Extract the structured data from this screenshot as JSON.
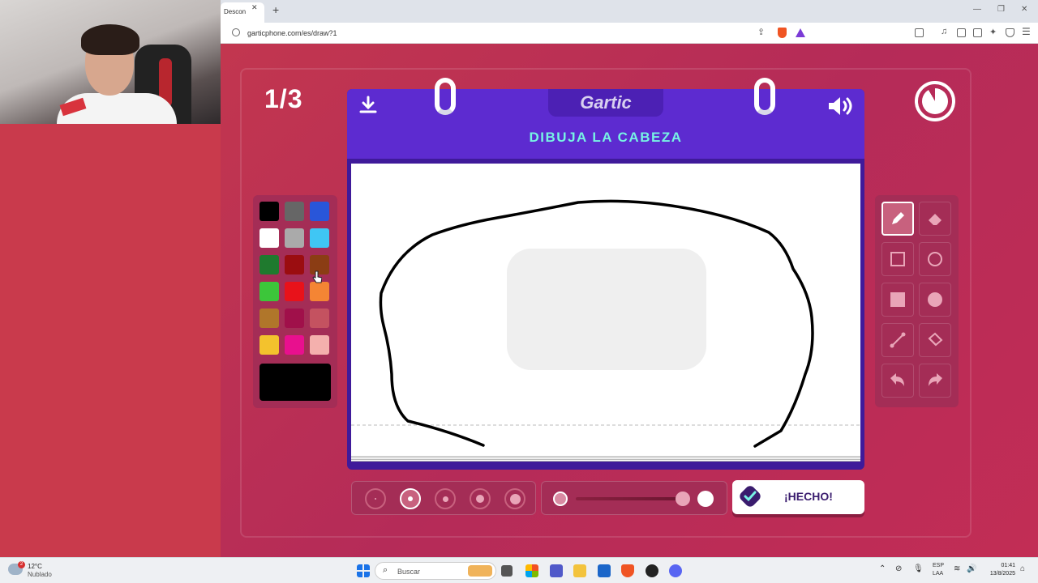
{
  "browser": {
    "tab_title": "Descon",
    "url": "garticphone.com/es/draw?1",
    "new_tab": "+",
    "close": "✕"
  },
  "game": {
    "round": "1/3",
    "logo": "Gartic",
    "prompt": "DIBUJA LA CABEZA",
    "done_label": "¡HECHO!",
    "timer_elapsed_fraction": 0.08,
    "selected_color": "#000000",
    "selected_tool": "pencil",
    "selected_size_index": 1,
    "opacity_fraction": 0.92,
    "palette": [
      "#000000",
      "#666666",
      "#2956d9",
      "#ffffff",
      "#aaaaaa",
      "#3fc6f4",
      "#1f7a2e",
      "#9b0d10",
      "#8b3d14",
      "#3cc63a",
      "#e8121a",
      "#f48534",
      "#b0762a",
      "#a0104a",
      "#c45260",
      "#f3c22d",
      "#e8108e",
      "#f4b0ad"
    ],
    "tools": [
      "pencil",
      "eraser",
      "rect-outline",
      "circle-outline",
      "rect-fill",
      "circle-fill",
      "line",
      "bucket",
      "undo",
      "redo"
    ]
  },
  "taskbar": {
    "temperature": "12°C",
    "condition": "Nublado",
    "search_placeholder": "Buscar",
    "notification_count": "2",
    "language": "ESP",
    "language_sub": "LAA",
    "time": "01:41",
    "date": "13/8/2025"
  },
  "colors": {
    "game_bg": "#c2364f",
    "book": "#5d2bd0",
    "prompt": "#77f2e4",
    "panel": "#a42d56"
  }
}
